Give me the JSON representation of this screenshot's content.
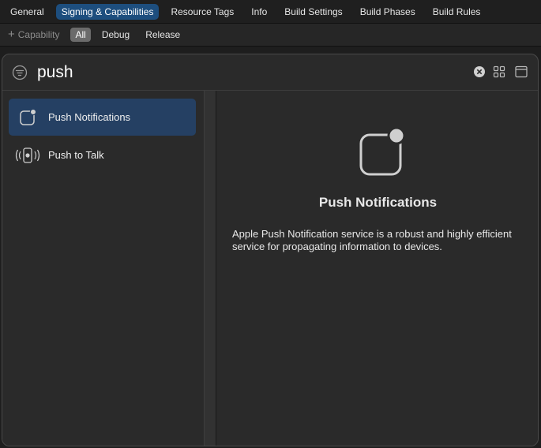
{
  "tabs": [
    {
      "label": "General",
      "active": false
    },
    {
      "label": "Signing & Capabilities",
      "active": true
    },
    {
      "label": "Resource Tags",
      "active": false
    },
    {
      "label": "Info",
      "active": false
    },
    {
      "label": "Build Settings",
      "active": false
    },
    {
      "label": "Build Phases",
      "active": false
    },
    {
      "label": "Build Rules",
      "active": false
    }
  ],
  "filterbar": {
    "add_capability_label": "Capability",
    "segments": [
      {
        "label": "All",
        "active": true
      },
      {
        "label": "Debug",
        "active": false
      },
      {
        "label": "Release",
        "active": false
      }
    ]
  },
  "search": {
    "value": "push"
  },
  "results": [
    {
      "label": "Push Notifications",
      "icon": "push-notifications-icon",
      "selected": true
    },
    {
      "label": "Push to Talk",
      "icon": "push-to-talk-icon",
      "selected": false
    }
  ],
  "detail": {
    "title": "Push Notifications",
    "icon": "push-notifications-icon",
    "description": "Apple Push Notification service is a robust and highly efficient service for propagating information to devices."
  },
  "colors": {
    "accent": "#1d4e7e",
    "selection": "#254063",
    "background": "#1e1e1e",
    "panel": "#2a2a2a"
  }
}
